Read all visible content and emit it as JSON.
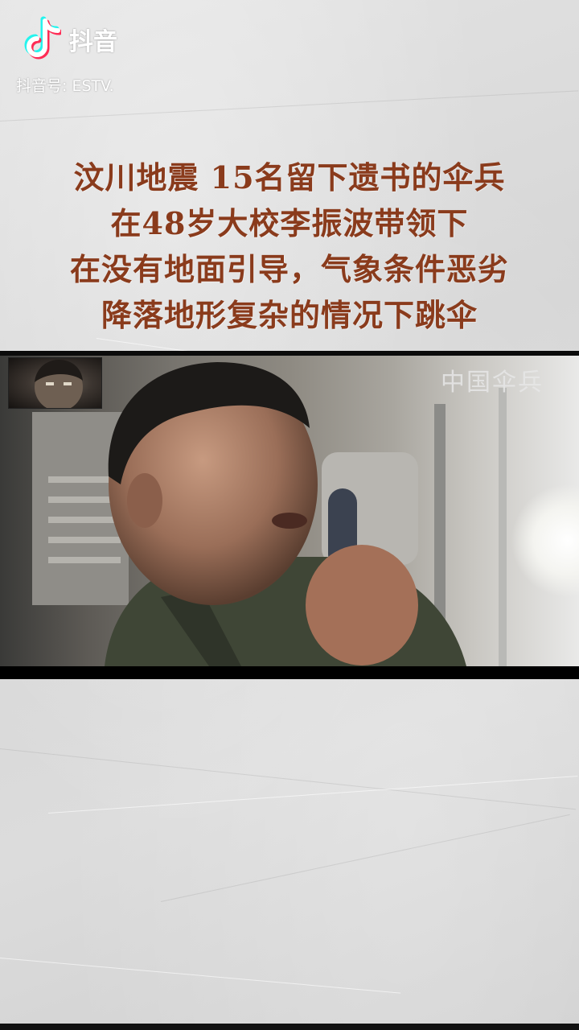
{
  "watermark": {
    "app_name": "抖音",
    "account_id": "抖音号: ESTV.",
    "logo_icon": "tiktok-note-icon"
  },
  "caption": {
    "lines": [
      "汶川地震   15名留下遗书的伞兵",
      "在48岁大校李振波带领下",
      "在没有地面引导，气象条件恶劣",
      "降落地形复杂的情况下跳伞"
    ],
    "color": "#8a3b1c"
  },
  "video": {
    "channel_label": "中国伞兵",
    "inset_photo": "portrait-thumbnail",
    "scene": "paratrooper-speaking-into-microphone"
  }
}
